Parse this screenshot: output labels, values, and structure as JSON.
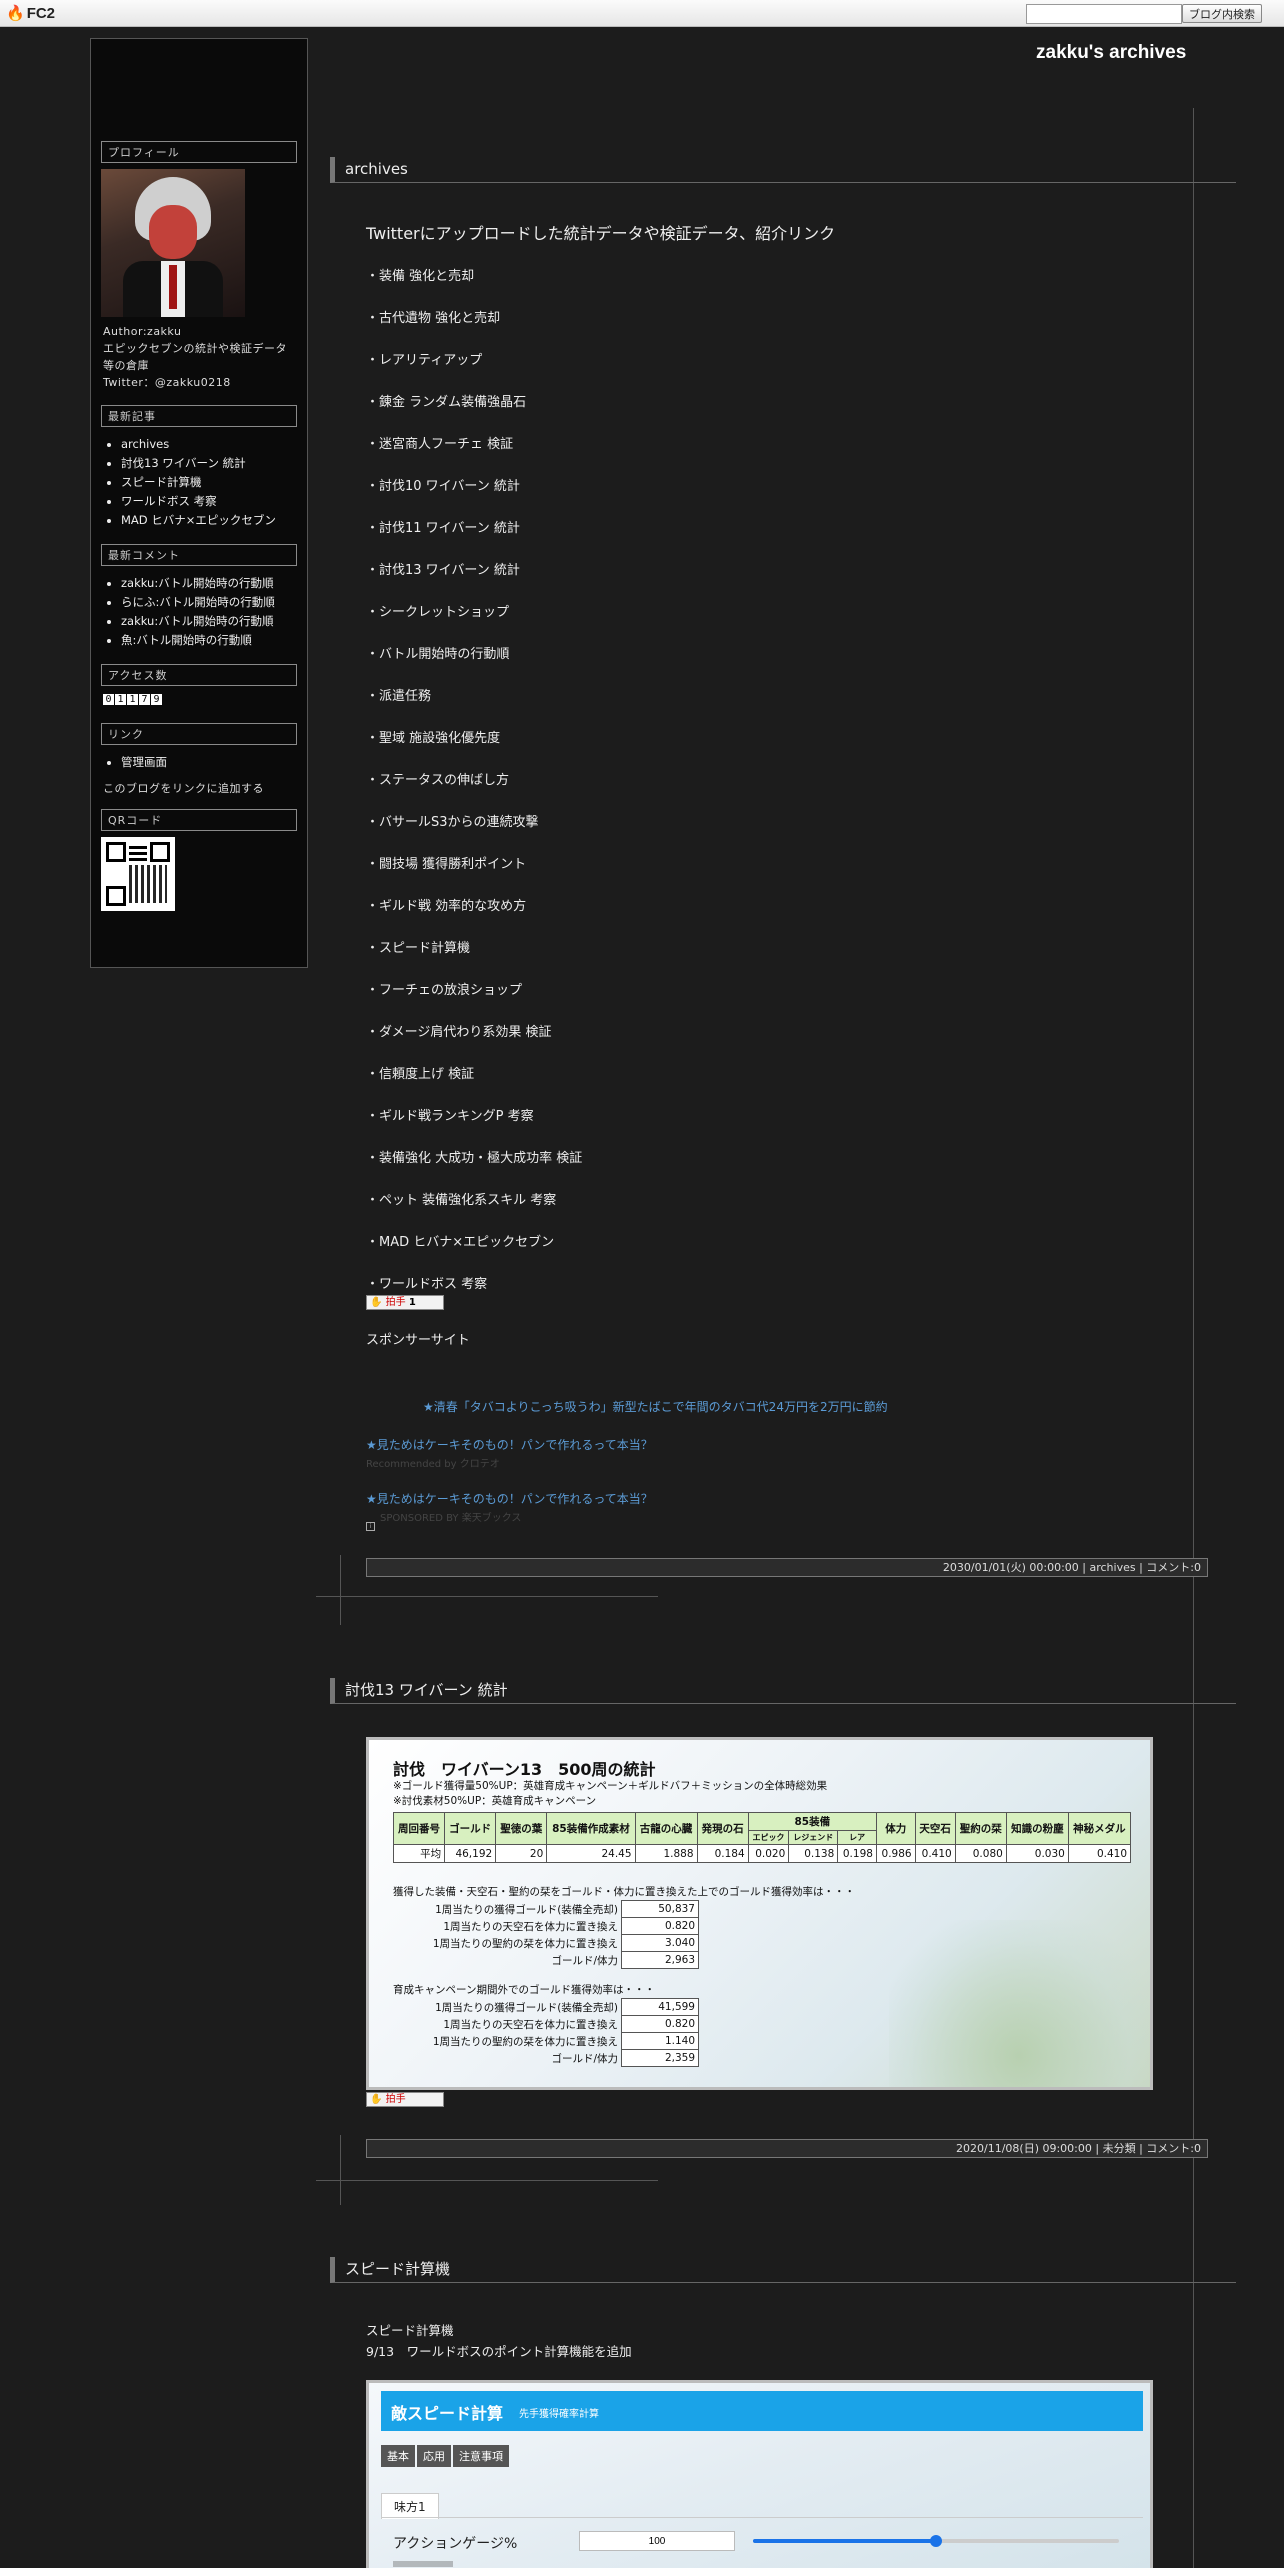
{
  "fc2": {
    "logo": "FC2",
    "search_button": "ブログ内検索"
  },
  "site_title": "zakku's archives",
  "sidebar": {
    "profile": {
      "heading": "プロフィール",
      "author": "Author:zakku",
      "desc": "エピックセブンの統計や検証データ等の倉庫",
      "twitter": "Twitter：@zakku0218"
    },
    "recent_posts": {
      "heading": "最新記事",
      "items": [
        "archives",
        "討伐13 ワイバーン 統計",
        "スピード計算機",
        "ワールドボス 考察",
        "MAD ヒバナ×エピックセブン"
      ]
    },
    "recent_comments": {
      "heading": "最新コメント",
      "items": [
        "zakku:バトル開始時の行動順",
        "らにふ:バトル開始時の行動順",
        "zakku:バトル開始時の行動順",
        "魚:バトル開始時の行動順"
      ]
    },
    "access": {
      "heading": "アクセス数",
      "digits": [
        "0",
        "1",
        "1",
        "7",
        "9"
      ]
    },
    "links": {
      "heading": "リンク",
      "items": [
        "管理画面"
      ],
      "add": "このブログをリンクに追加する"
    },
    "qr": {
      "heading": "QRコード"
    }
  },
  "entries": [
    {
      "title": "archives",
      "subtitle": "Twitterにアップロードした統計データや検証データ、紹介リンク",
      "links": [
        "・装備 強化と売却",
        "・古代遺物 強化と売却",
        "・レアリティアップ",
        "・錬金 ランダム装備強晶石",
        "・迷宮商人フーチェ 検証",
        "・討伐10 ワイバーン 統計",
        "・討伐11 ワイバーン 統計",
        "・討伐13 ワイバーン 統計",
        "・シークレットショップ",
        "・バトル開始時の行動順",
        "・派遣任務",
        "・聖域 施設強化優先度",
        "・ステータスの伸ばし方",
        "・バサールS3からの連続攻撃",
        "・闘技場 獲得勝利ポイント",
        "・ギルド戦 効率的な攻め方",
        "・スピード計算機",
        "・フーチェの放浪ショップ",
        "・ダメージ肩代わり系効果 検証",
        "・信頼度上げ 検証",
        "・ギルド戦ランキングP 考察",
        "・装備強化 大成功・極大成功率 検証",
        "・ペット 装備強化系スキル 考察",
        "・MAD ヒバナ×エピックセブン",
        "・ワールドボス 考察"
      ],
      "clap": "拍手",
      "clap_count": "1",
      "sponsor_heading": "スポンサーサイト",
      "sponsor1": "★清春「タバコよりこっち吸うわ」新型たばこで年間のタバコ代24万円を2万円に節約",
      "sponsor2": "★見ためはケーキそのもの！パンで作れるって本当？",
      "sponsor2_sub": "Recommended by クロテオ",
      "sponsor3": "★見ためはケーキそのもの！パンで作れるって本当？",
      "sponsor3_sub": "SPONSORED BY 楽天ブックス",
      "footer": "2030/01/01(火) 00:00:00 | archives | コメント:0"
    },
    {
      "title": "討伐13 ワイバーン 統計",
      "clap": "拍手",
      "footer": "2020/11/08(日) 09:00:00 | 未分類 | コメント:0"
    },
    {
      "title": "スピード計算機",
      "body1": "スピード計算機",
      "body2": "9/13　ワールドボスのポイント計算機能を追加"
    }
  ],
  "stats_image": {
    "title": "討伐　ワイバーン13　500周の統計",
    "note1": "※ゴールド獲得量50%UP：英雄育成キャンペーン＋ギルドバフ＋ミッションの全体時総効果",
    "note2": "※討伐素材50%UP：英雄育成キャンペーン",
    "headers": [
      "周回番号",
      "ゴールド",
      "聖徳の葉",
      "85装備作成素材",
      "古龍の心臓",
      "発現の石",
      "85装備",
      "体力",
      "天空石",
      "聖約の栞",
      "知識の粉塵",
      "神秘メダル"
    ],
    "sub_headers": [
      "エピック",
      "レジェンド",
      "レア"
    ],
    "avg": [
      "平均",
      "46,192",
      "20",
      "24.45",
      "1.888",
      "0.184",
      "0.020",
      "0.138",
      "0.198",
      "0.986",
      "0.410",
      "0.080",
      "0.030",
      "0.410"
    ],
    "section1": "獲得した装備・天空石・聖約の栞をゴールド・体力に置き換えた上でのゴールド獲得効率は・・・",
    "rows1": [
      [
        "1周当たりの獲得ゴールド(装備全売却)",
        "50,837"
      ],
      [
        "1周当たりの天空石を体力に置き換え",
        "0.820"
      ],
      [
        "1周当たりの聖約の栞を体力に置き換え",
        "3.040"
      ],
      [
        "ゴールド/体力",
        "2,963"
      ]
    ],
    "section2": "育成キャンペーン期間外でのゴールド獲得効率は・・・",
    "rows2": [
      [
        "1周当たりの獲得ゴールド(装備全売却)",
        "41,599"
      ],
      [
        "1周当たりの天空石を体力に置き換え",
        "0.820"
      ],
      [
        "1周当たりの聖約の栞を体力に置き換え",
        "1.140"
      ],
      [
        "ゴールド/体力",
        "2,359"
      ]
    ]
  },
  "speed_image": {
    "title": "敵スピード計算",
    "subtitle": "先手獲得確率計算",
    "tabs": [
      "基本",
      "応用",
      "注意事項"
    ],
    "ally_tab": "味方1",
    "gauge_label": "アクションゲージ%",
    "gauge_value": "100",
    "gauge_percent": 0.5
  }
}
